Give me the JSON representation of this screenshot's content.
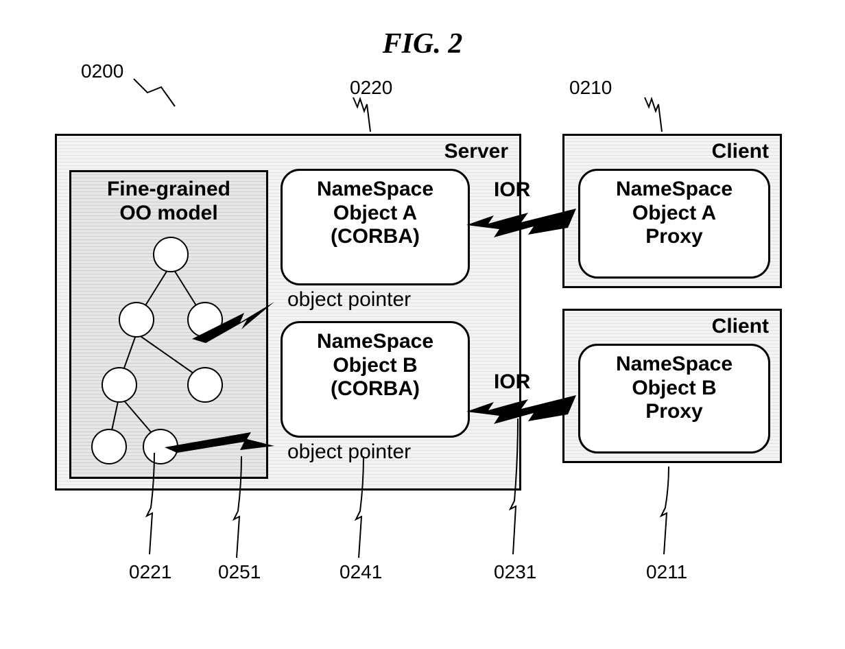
{
  "figure_title": "FIG. 2",
  "server": {
    "label": "Server",
    "oo_panel": {
      "line1": "Fine-grained",
      "line2": "OO model"
    },
    "ns_a": {
      "line1": "NameSpace",
      "line2": "Object A",
      "line3": "(CORBA)",
      "caption": "object pointer"
    },
    "ns_b": {
      "line1": "NameSpace",
      "line2": "Object B",
      "line3": "(CORBA)",
      "caption": "object pointer"
    }
  },
  "client_a": {
    "label": "Client",
    "proxy": {
      "line1": "NameSpace",
      "line2": "Object A",
      "line3": "Proxy"
    }
  },
  "client_b": {
    "label": "Client",
    "proxy": {
      "line1": "NameSpace",
      "line2": "Object B",
      "line3": "Proxy"
    }
  },
  "ior_label": "IOR",
  "refs": {
    "r0200": "0200",
    "r0210": "0210",
    "r0211": "0211",
    "r0220": "0220",
    "r0221": "0221",
    "r0231": "0231",
    "r0241": "0241",
    "r0251": "0251"
  }
}
